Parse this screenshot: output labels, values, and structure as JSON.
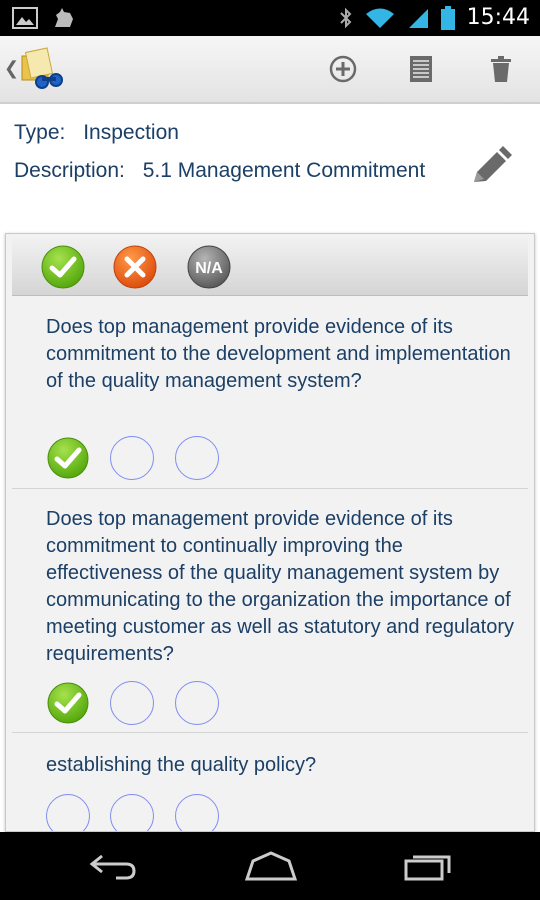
{
  "status_bar": {
    "time": "15:44",
    "icons": [
      "image-icon",
      "android-debug-icon",
      "bluetooth-icon",
      "wifi-icon",
      "signal-icon",
      "battery-icon"
    ]
  },
  "action_bar": {
    "icons": [
      "back-chevron-icon",
      "app-logo-icon",
      "add-icon",
      "list-icon",
      "trash-icon"
    ]
  },
  "info": {
    "type_label": "Type:",
    "type_value": "Inspection",
    "description_label": "Description:",
    "description_value": "5.1 Management Commitment"
  },
  "legend": {
    "yes_icon": "checkmark-icon",
    "no_icon": "x-icon",
    "na_label": "N/A"
  },
  "questions": [
    {
      "text": "Does top management provide evidence of its commitment to the development and implementation of the quality management system?",
      "selected": "yes"
    },
    {
      "text": "Does top management provide evidence of its commitment to continually improving the effectiveness of the quality management system by communicating to the organization the importance of meeting customer as well as statutory and regulatory requirements?",
      "selected": "yes"
    },
    {
      "text": "establishing the quality policy?",
      "selected": "none"
    }
  ],
  "nav_bar": {
    "icons": [
      "back-icon",
      "home-icon",
      "recent-apps-icon"
    ]
  },
  "colors": {
    "text": "#1c3f66",
    "yes": "#6cc01e",
    "no": "#f0641e",
    "na": "#777777",
    "option_border": "#7f8df0"
  }
}
